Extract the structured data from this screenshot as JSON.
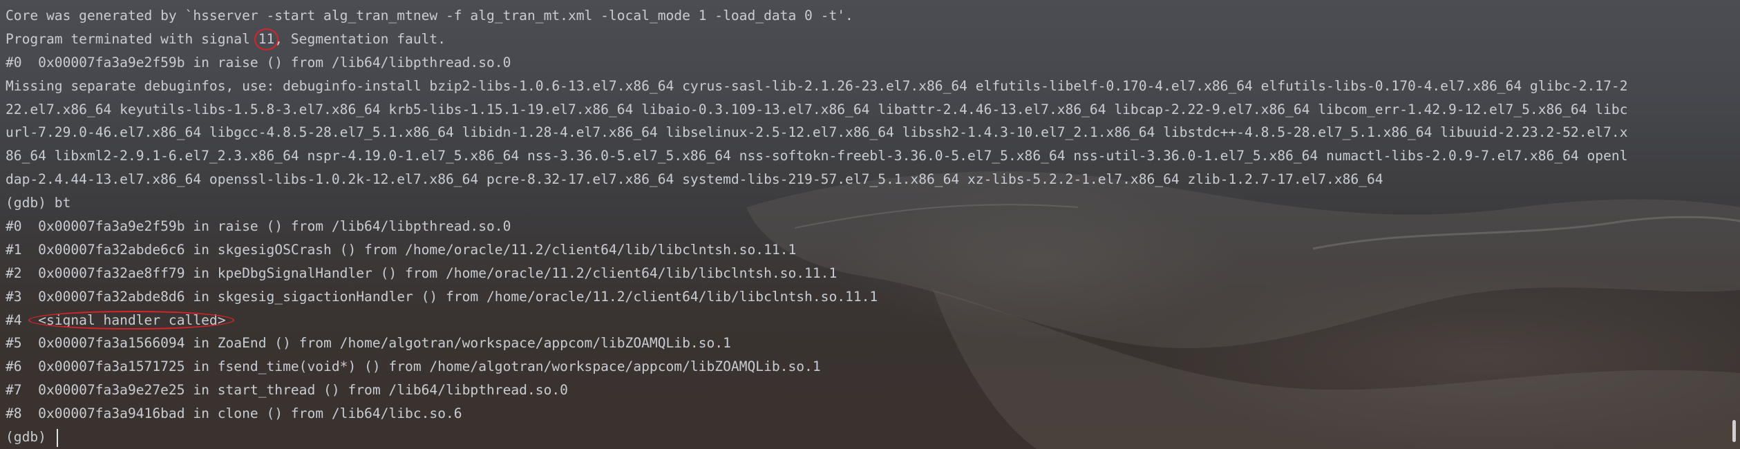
{
  "terminal": {
    "line_01": "Core was generated by `hsserver -start alg_tran_mtnew -f alg_tran_mt.xml -local_mode 1 -load_data 0 -t'.",
    "line_02_pre": "Program terminated with signal ",
    "line_02_signal": "11",
    "line_02_post": ", Segmentation fault.",
    "line_03": "#0  0x00007fa3a9e2f59b in raise () from /lib64/libpthread.so.0",
    "line_04": "Missing separate debuginfos, use: debuginfo-install bzip2-libs-1.0.6-13.el7.x86_64 cyrus-sasl-lib-2.1.26-23.el7.x86_64 elfutils-libelf-0.170-4.el7.x86_64 elfutils-libs-0.170-4.el7.x86_64 glibc-2.17-2",
    "line_05": "22.el7.x86_64 keyutils-libs-1.5.8-3.el7.x86_64 krb5-libs-1.15.1-19.el7.x86_64 libaio-0.3.109-13.el7.x86_64 libattr-2.4.46-13.el7.x86_64 libcap-2.22-9.el7.x86_64 libcom_err-1.42.9-12.el7_5.x86_64 libc",
    "line_06": "url-7.29.0-46.el7.x86_64 libgcc-4.8.5-28.el7_5.1.x86_64 libidn-1.28-4.el7.x86_64 libselinux-2.5-12.el7.x86_64 libssh2-1.4.3-10.el7_2.1.x86_64 libstdc++-4.8.5-28.el7_5.1.x86_64 libuuid-2.23.2-52.el7.x",
    "line_07": "86_64 libxml2-2.9.1-6.el7_2.3.x86_64 nspr-4.19.0-1.el7_5.x86_64 nss-3.36.0-5.el7_5.x86_64 nss-softokn-freebl-3.36.0-5.el7_5.x86_64 nss-util-3.36.0-1.el7_5.x86_64 numactl-libs-2.0.9-7.el7.x86_64 openl",
    "line_08": "dap-2.4.44-13.el7.x86_64 openssl-libs-1.0.2k-12.el7.x86_64 pcre-8.32-17.el7.x86_64 systemd-libs-219-57.el7_5.1.x86_64 xz-libs-5.2.2-1.el7.x86_64 zlib-1.2.7-17.el7.x86_64",
    "line_09": "(gdb) bt",
    "bt_0": "#0  0x00007fa3a9e2f59b in raise () from /lib64/libpthread.so.0",
    "bt_1": "#1  0x00007fa32abde6c6 in skgesigOSCrash () from /home/oracle/11.2/client64/lib/libclntsh.so.11.1",
    "bt_2": "#2  0x00007fa32ae8ff79 in kpeDbgSignalHandler () from /home/oracle/11.2/client64/lib/libclntsh.so.11.1",
    "bt_3": "#3  0x00007fa32abde8d6 in skgesig_sigactionHandler () from /home/oracle/11.2/client64/lib/libclntsh.so.11.1",
    "bt_4_num": "#4  ",
    "bt_4_frame": "<signal handler called>",
    "bt_5": "#5  0x00007fa3a1566094 in ZoaEnd () from /home/algotran/workspace/appcom/libZOAMQLib.so.1",
    "bt_6": "#6  0x00007fa3a1571725 in fsend_time(void*) () from /home/algotran/workspace/appcom/libZOAMQLib.so.1",
    "bt_7": "#7  0x00007fa3a9e27e25 in start_thread () from /lib64/libpthread.so.0",
    "bt_8": "#8  0x00007fa3a9416bad in clone () from /lib64/libc.so.6",
    "prompt": "(gdb) "
  },
  "colors": {
    "text": "#c9ccd2",
    "annotation": "#d8232a"
  }
}
